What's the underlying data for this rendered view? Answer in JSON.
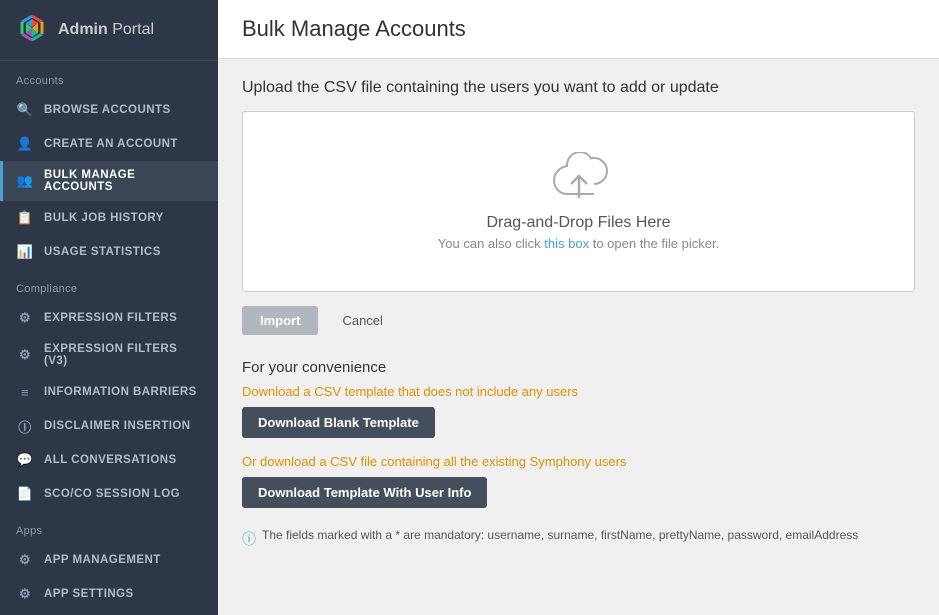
{
  "sidebar": {
    "logo_text_bold": "Admin",
    "logo_text_regular": " Portal",
    "sections": [
      {
        "label": "Accounts",
        "items": [
          {
            "id": "browse-accounts",
            "label": "BROWSE ACCOUNTS",
            "icon": "🔍",
            "active": false
          },
          {
            "id": "create-account",
            "label": "CREATE AN ACCOUNT",
            "icon": "👤",
            "active": false
          },
          {
            "id": "bulk-manage",
            "label": "BULK MANAGE ACCOUNTS",
            "icon": "👥",
            "active": true
          },
          {
            "id": "bulk-job-history",
            "label": "BULK JOB HISTORY",
            "icon": "📋",
            "active": false
          },
          {
            "id": "usage-statistics",
            "label": "USAGE STATISTICS",
            "icon": "📊",
            "active": false
          }
        ]
      },
      {
        "label": "Compliance",
        "items": [
          {
            "id": "expression-filters",
            "label": "EXPRESSION FILTERS",
            "icon": "⚙",
            "active": false
          },
          {
            "id": "expression-filters-v3",
            "label": "EXPRESSION FILTERS (V3)",
            "icon": "⚙",
            "active": false
          },
          {
            "id": "information-barriers",
            "label": "INFORMATION BARRIERS",
            "icon": "≡",
            "active": false
          },
          {
            "id": "disclaimer-insertion",
            "label": "DISCLAIMER INSERTION",
            "icon": "ℹ",
            "active": false
          },
          {
            "id": "all-conversations",
            "label": "ALL CONVERSATIONS",
            "icon": "💬",
            "active": false
          },
          {
            "id": "sco-session-log",
            "label": "SCO/CO SESSION LOG",
            "icon": "📄",
            "active": false
          }
        ]
      },
      {
        "label": "Apps",
        "items": [
          {
            "id": "app-management",
            "label": "APP MANAGEMENT",
            "icon": "⚙",
            "active": false
          },
          {
            "id": "app-settings",
            "label": "APP SETTINGS",
            "icon": "⚙",
            "active": false
          }
        ]
      }
    ]
  },
  "main": {
    "title": "Bulk Manage Accounts",
    "upload_instruction": "Upload the CSV file containing the users you want to add or update",
    "drop_zone": {
      "main_text": "Drag-and-Drop Files Here",
      "sub_text_prefix": "You can also click ",
      "sub_text_link": "this box",
      "sub_text_suffix": " to open the file picker."
    },
    "buttons": {
      "import": "Import",
      "cancel": "Cancel"
    },
    "convenience": {
      "title": "For your convenience",
      "blank_desc": "Download a CSV template that does not include any users",
      "blank_btn": "Download Blank Template",
      "userinfo_desc": "Or download a CSV file containing all the existing Symphony users",
      "userinfo_btn": "Download Template With User Info",
      "mandatory_note": "The fields marked with a * are mandatory: username, surname, firstName, prettyName, password, emailAddress"
    }
  }
}
